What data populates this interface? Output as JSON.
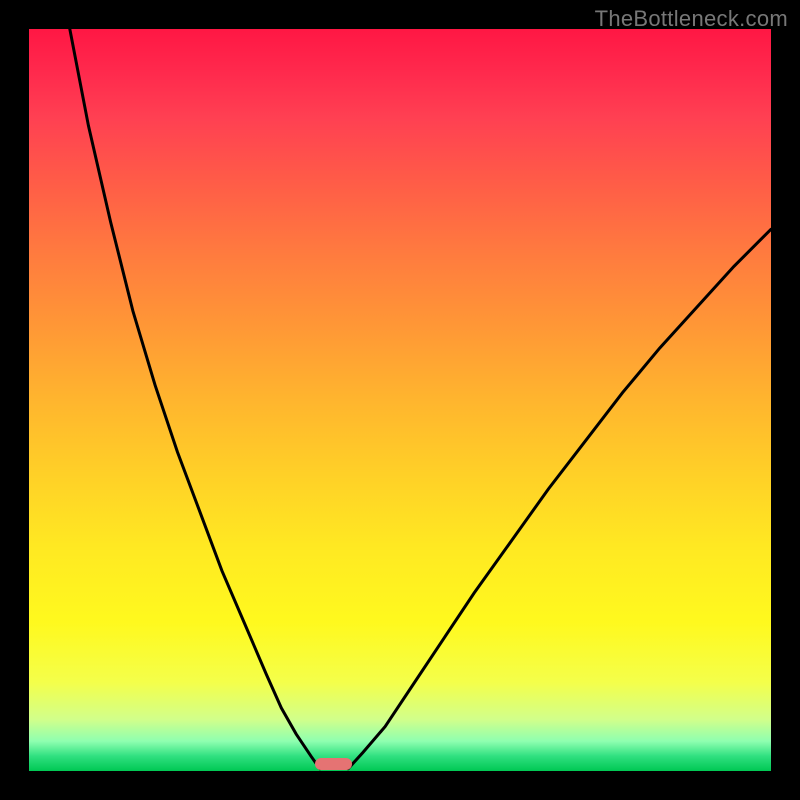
{
  "watermark": "TheBottleneck.com",
  "chart_data": {
    "type": "line",
    "title": "",
    "xlabel": "",
    "ylabel": "",
    "xlim": [
      0,
      100
    ],
    "ylim": [
      0,
      100
    ],
    "grid": false,
    "series": [
      {
        "name": "left-curve",
        "x": [
          5.5,
          8,
          11,
          14,
          17,
          20,
          23,
          26,
          29,
          32,
          34,
          36,
          38,
          39.2
        ],
        "y": [
          100,
          87,
          74,
          62,
          52,
          43,
          35,
          27,
          20,
          13,
          8.5,
          5,
          2,
          0.3
        ]
      },
      {
        "name": "right-curve",
        "x": [
          43,
          45,
          48,
          52,
          56,
          60,
          65,
          70,
          75,
          80,
          85,
          90,
          95,
          100
        ],
        "y": [
          0.3,
          2.5,
          6,
          12,
          18,
          24,
          31,
          38,
          44.5,
          51,
          57,
          62.5,
          68,
          73
        ]
      }
    ],
    "marker": {
      "name": "bottleneck-point",
      "x_center": 41,
      "width_pct": 5,
      "y": 0.5
    },
    "background_gradient": {
      "top": "#ff1744",
      "mid": "#ffe922",
      "bottom": "#00c853"
    }
  }
}
